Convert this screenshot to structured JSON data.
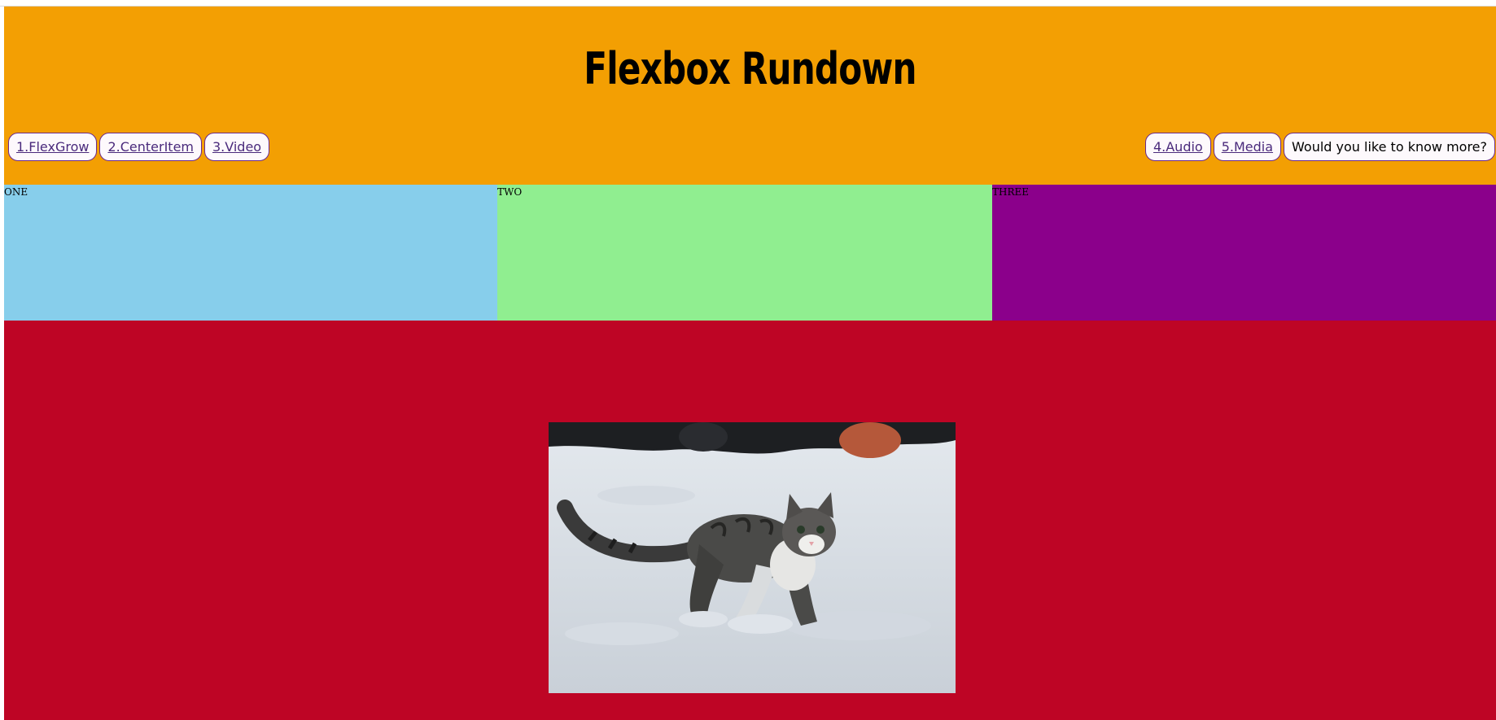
{
  "header": {
    "title": "Flexbox Rundown",
    "bg_color": "#f39f03"
  },
  "nav_left": [
    {
      "label": "1.FlexGrow"
    },
    {
      "label": "2.CenterItem"
    },
    {
      "label": "3.Video"
    }
  ],
  "nav_right": [
    {
      "label": "4.Audio"
    },
    {
      "label": "5.Media"
    },
    {
      "label": "Would you like to know more?"
    }
  ],
  "boxes": [
    {
      "label": "ONE",
      "color": "#87ceeb"
    },
    {
      "label": "TWO",
      "color": "#90ee90"
    },
    {
      "label": "THREE",
      "color": "#8b008b"
    }
  ],
  "media": {
    "bg_color": "#be0525",
    "image": "cat-in-snow-photo"
  }
}
